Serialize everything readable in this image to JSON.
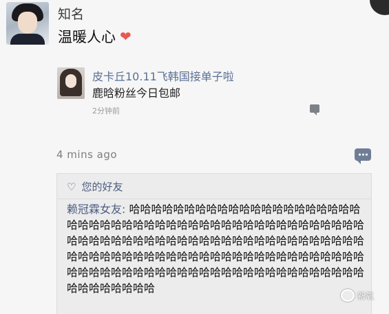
{
  "post": {
    "author": "知名",
    "content": "温暖人心",
    "emoji_icon": "heart-icon",
    "time": "4 mins ago"
  },
  "repost": {
    "author": "皮卡丘10.11飞韩国接单子啦",
    "content": "鹿晗粉丝今日包邮",
    "time": "2分钟前"
  },
  "comments": {
    "likes_label": "您的好友",
    "items": [
      {
        "author": "赖冠霖女友:",
        "text": " 哈哈哈哈哈哈哈哈哈哈哈哈哈哈哈哈哈哈哈哈哈哈哈哈哈哈哈哈哈哈哈哈哈哈哈哈哈哈哈哈哈哈哈哈哈哈哈哈哈哈哈哈哈哈哈哈哈哈哈哈哈哈哈哈哈哈哈哈哈哈哈哈哈哈哈哈哈哈哈哈哈哈哈哈哈哈哈哈哈哈哈哈哈哈哈哈哈哈哈哈哈哈哈哈哈哈哈哈哈哈哈哈哈哈哈哈哈哈哈哈哈哈哈哈哈哈哈哈哈哈哈哈哈哈哈哈哈"
      }
    ]
  },
  "watermark": "新氧",
  "colors": {
    "link": "#4c5d80",
    "heart": "#e85a4f",
    "background": "#f6f6f6",
    "panel": "#ececec"
  }
}
